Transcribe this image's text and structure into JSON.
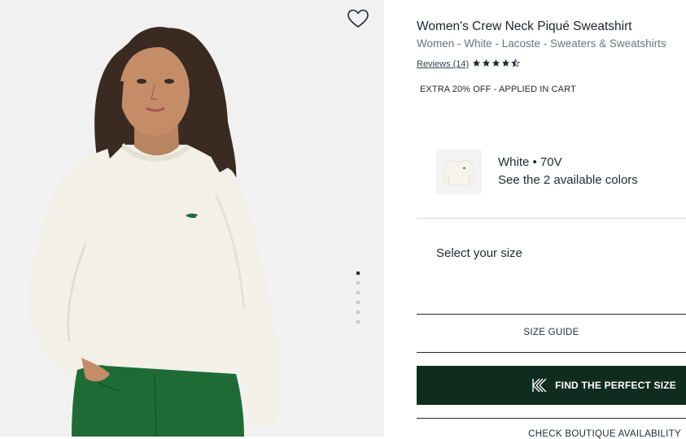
{
  "product": {
    "title": "Women's Crew Neck Piqué Sweatshirt",
    "breadcrumb": "Women - White - Lacoste - Sweaters & Sweatshirts",
    "reviews_label": "Reviews (14)",
    "rating": 4.5,
    "rating_max": 5,
    "promo": "EXTRA 20% OFF - APPLIED IN CART"
  },
  "color": {
    "current": "White • 70V",
    "more_link": "See the 2 available colors"
  },
  "size": {
    "select_label": "Select your size",
    "guide_label": "SIZE GUIDE",
    "perfect_label": "FIND THE PERFECT SIZE",
    "boutique_label": "CHECK BOUTIQUE AVAILABILITY"
  },
  "gallery": {
    "image_count": 6,
    "active_index": 0
  },
  "colors": {
    "accent": "#0f2c1f",
    "sweater": "#f3f0e8",
    "jeans": "#1f6b36"
  }
}
